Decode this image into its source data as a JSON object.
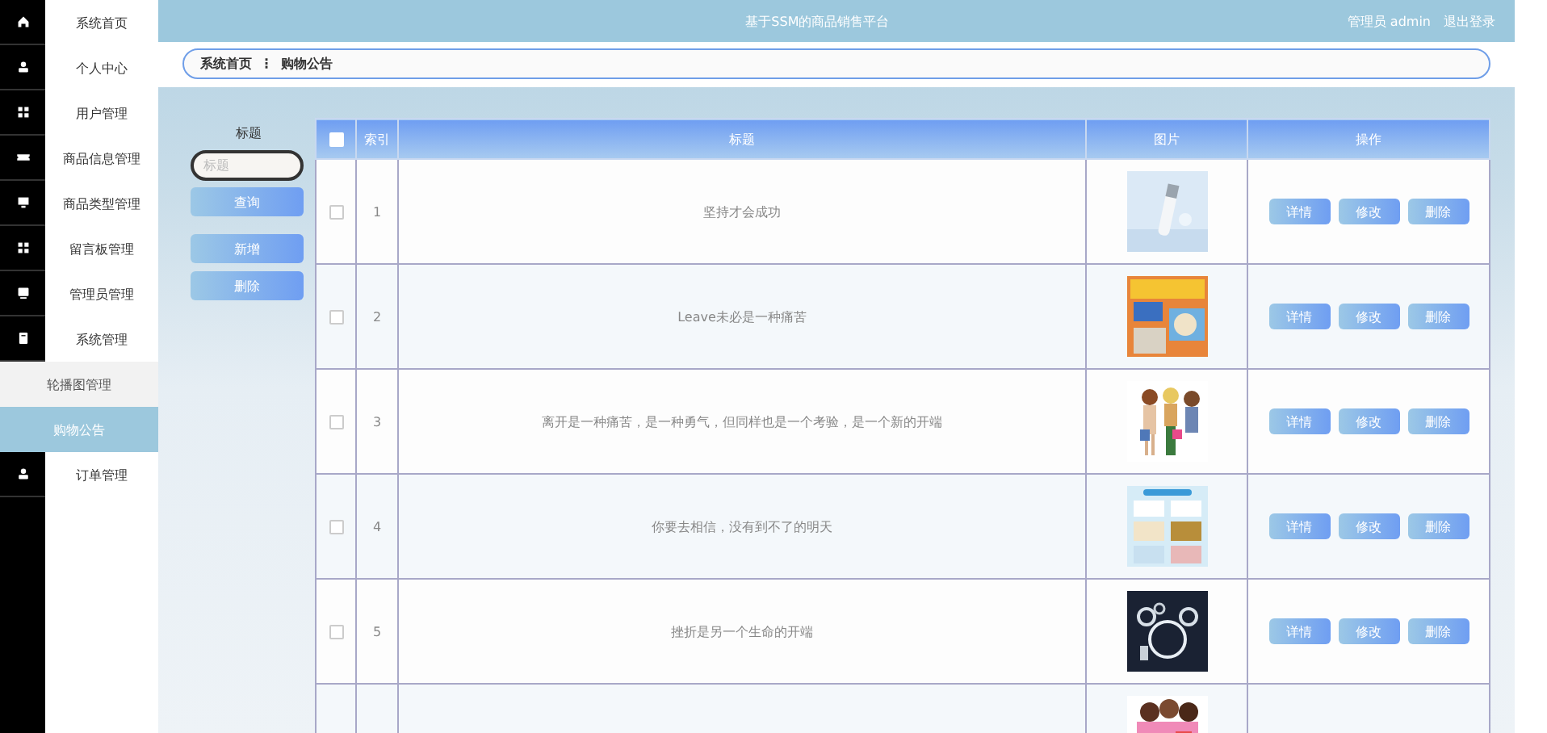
{
  "sidebar": {
    "items": [
      {
        "label": "系统首页",
        "kind": "menu",
        "selected": false
      },
      {
        "label": "个人中心",
        "kind": "menu",
        "selected": false
      },
      {
        "label": "用户管理",
        "kind": "menu",
        "selected": false
      },
      {
        "label": "商品信息管理",
        "kind": "menu",
        "selected": false
      },
      {
        "label": "商品类型管理",
        "kind": "menu",
        "selected": false
      },
      {
        "label": "留言板管理",
        "kind": "menu",
        "selected": false
      },
      {
        "label": "管理员管理",
        "kind": "menu",
        "selected": false
      },
      {
        "label": "系统管理",
        "kind": "menu",
        "selected": false
      },
      {
        "label": "轮播图管理",
        "kind": "submenu",
        "selected": false
      },
      {
        "label": "购物公告",
        "kind": "submenu",
        "selected": true
      },
      {
        "label": "订单管理",
        "kind": "menu",
        "selected": false
      }
    ]
  },
  "header": {
    "title": "基于SSM的商品销售平台",
    "user": "管理员 admin",
    "logout": "退出登录"
  },
  "breadcrumb": {
    "items": [
      "系统首页",
      "购物公告"
    ],
    "separator": "⋮"
  },
  "search": {
    "label": "标题",
    "placeholder": "标题",
    "buttons": [
      "查询",
      "新增",
      "删除"
    ]
  },
  "table": {
    "select_all_checked": false,
    "columns": [
      "索引",
      "标题",
      "图片",
      "操作"
    ],
    "rows": [
      {
        "checked": false,
        "index": "1",
        "title": "坚持才会成功",
        "actions": [
          "详情",
          "修改",
          "删除"
        ]
      },
      {
        "checked": false,
        "index": "2",
        "title": "Leave未必是一种痛苦",
        "actions": [
          "详情",
          "修改",
          "删除"
        ]
      },
      {
        "checked": false,
        "index": "3",
        "title": "离开是一种痛苦，是一种勇气，但同样也是一个考验，是一个新的开端",
        "actions": [
          "详情",
          "修改",
          "删除"
        ]
      },
      {
        "checked": false,
        "index": "4",
        "title": "你要去相信，没有到不了的明天",
        "actions": [
          "详情",
          "修改",
          "删除"
        ]
      },
      {
        "checked": false,
        "index": "5",
        "title": "挫折是另一个生命的开端",
        "actions": [
          "详情",
          "修改",
          "删除"
        ]
      },
      {
        "kind": "cut_off"
      }
    ]
  }
}
